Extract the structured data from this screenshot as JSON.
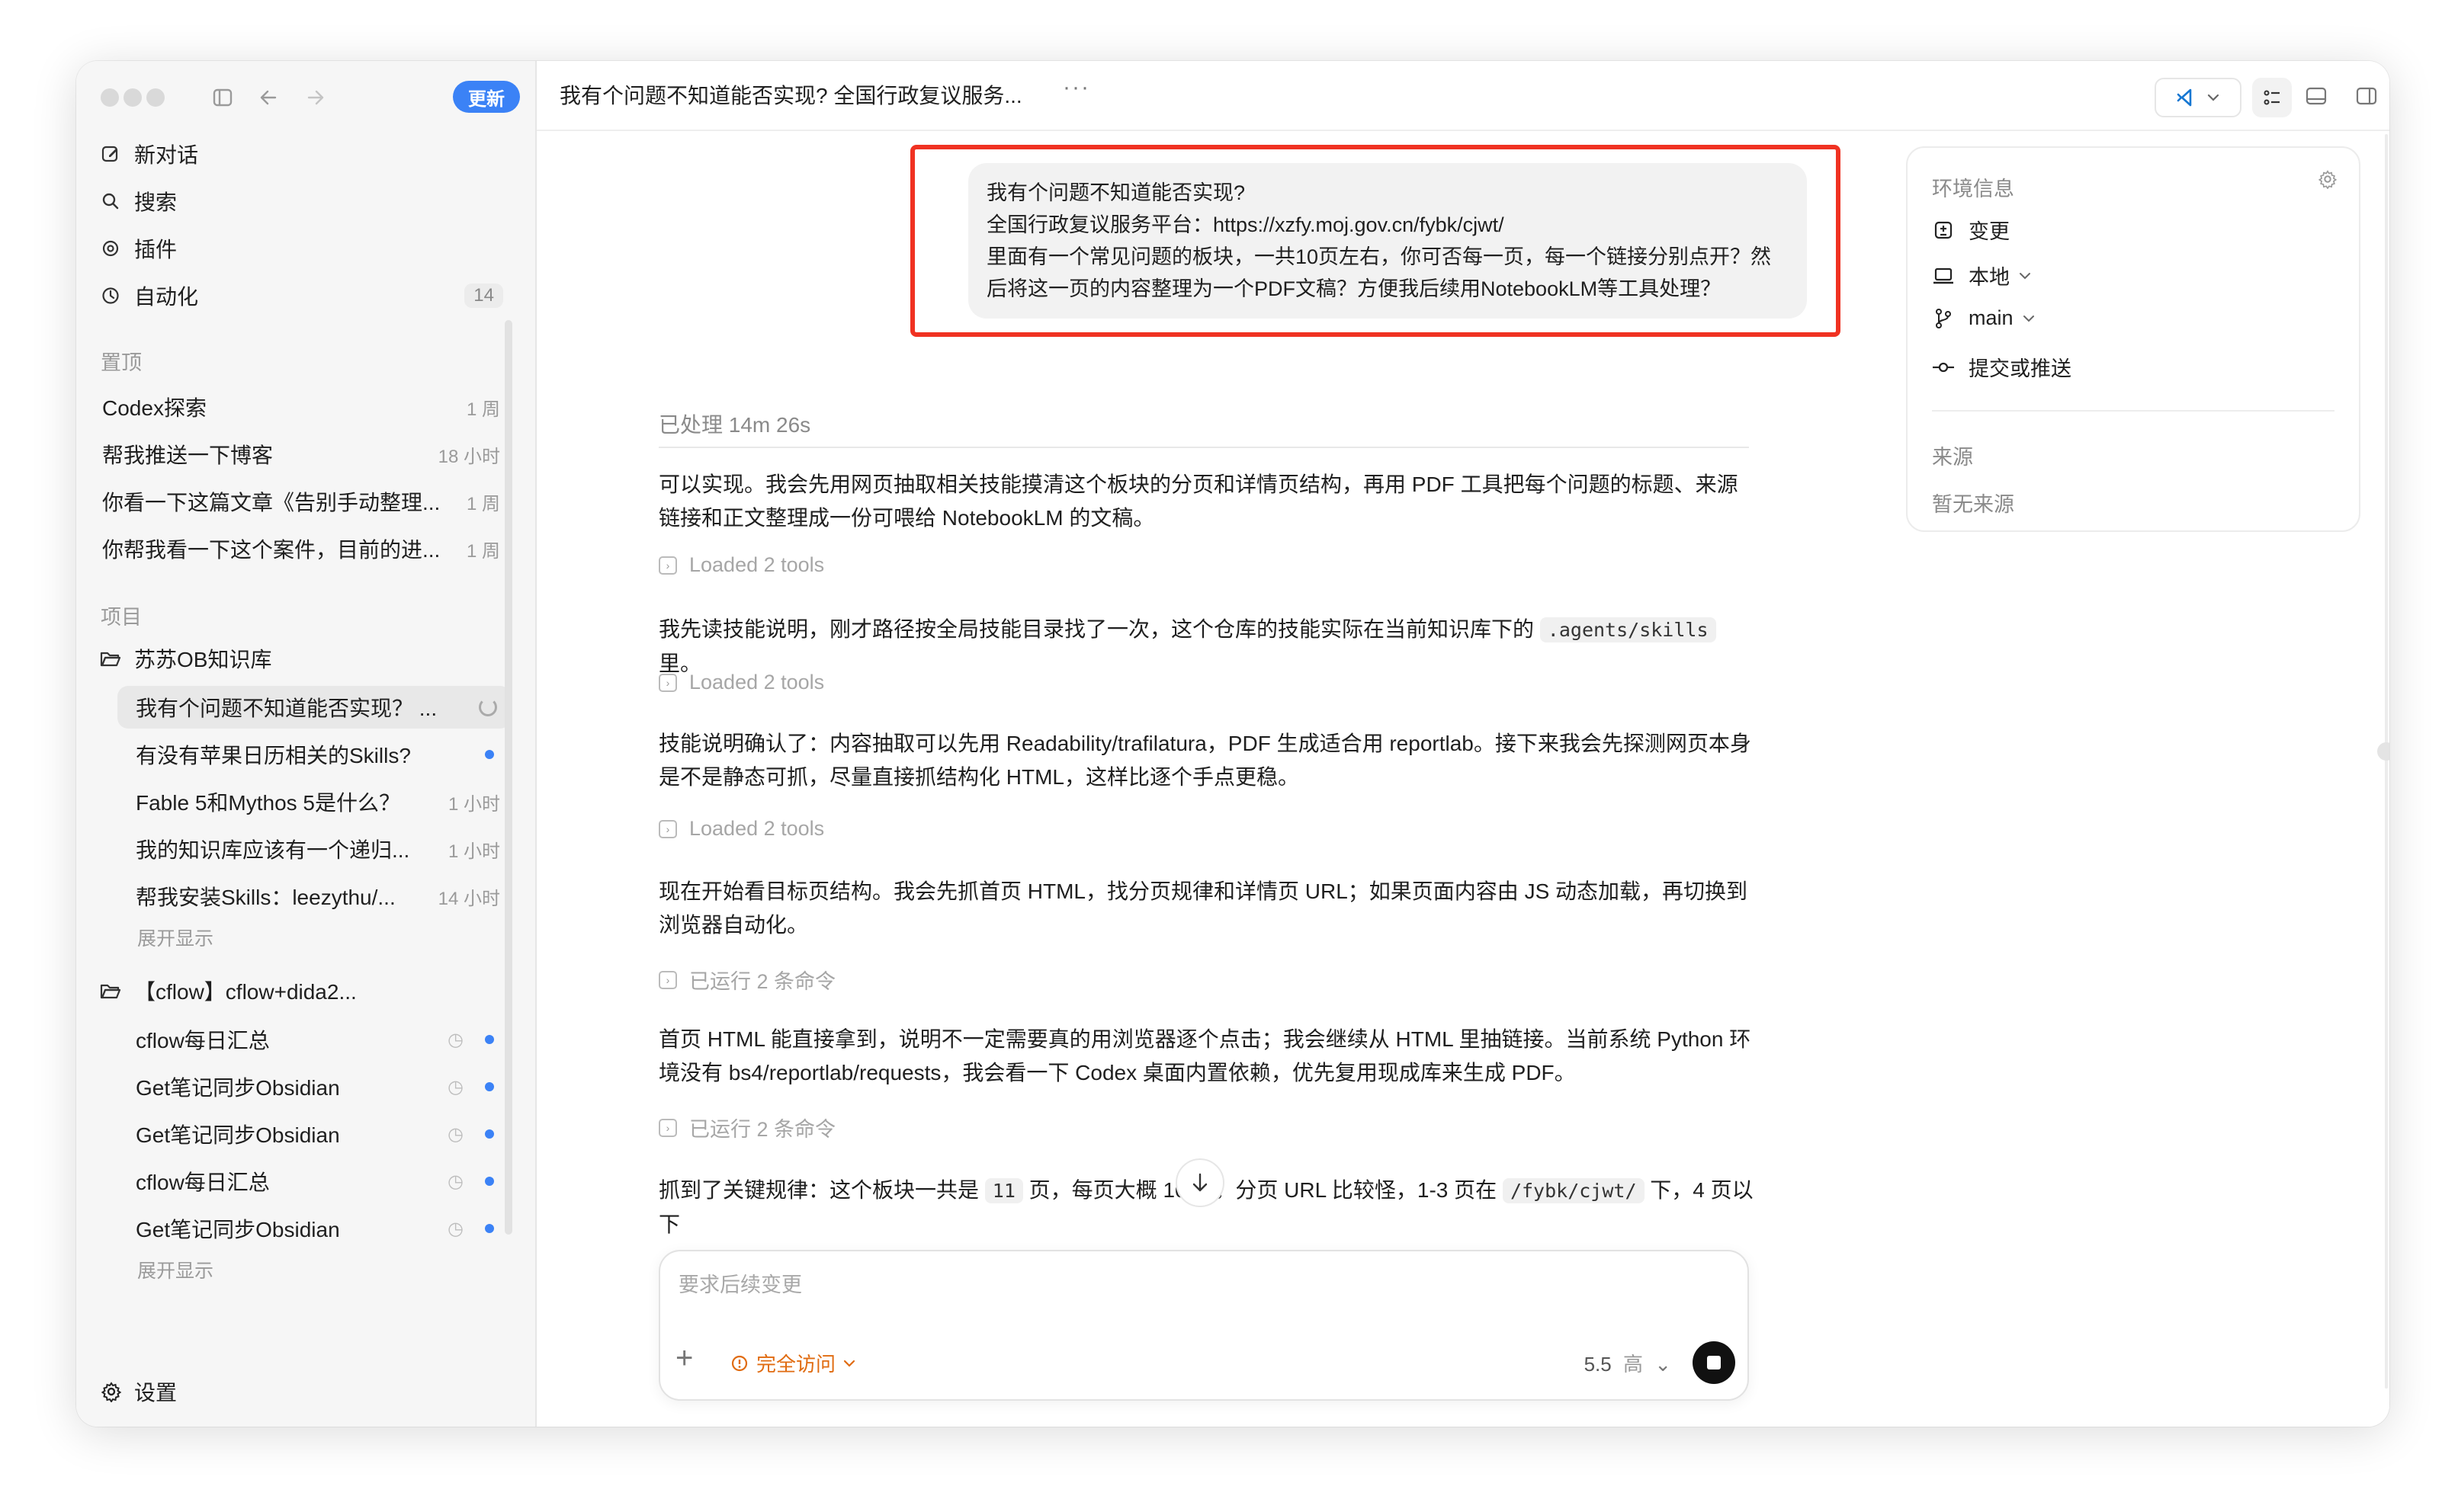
{
  "sidebar": {
    "update_label": "更新",
    "nav": [
      {
        "label": "新对话"
      },
      {
        "label": "搜索"
      },
      {
        "label": "插件"
      },
      {
        "label": "自动化",
        "badge": "14"
      }
    ],
    "pinned_label": "置顶",
    "pinned": [
      {
        "title": "Codex探索",
        "time": "1 周"
      },
      {
        "title": "帮我推送一下博客",
        "time": "18 小时"
      },
      {
        "title": "你看一下这篇文章《告别手动整理...",
        "time": "1 周"
      },
      {
        "title": "你帮我看一下这个案件，目前的进...",
        "time": "1 周"
      }
    ],
    "projects_label": "项目",
    "project1": {
      "name": "苏苏OB知识库",
      "threads": [
        {
          "title": "我有个问题不知道能否实现？ ...",
          "time": ""
        },
        {
          "title": "有没有苹果日历相关的Skills?",
          "time": ""
        },
        {
          "title": "Fable 5和Mythos 5是什么？",
          "time": "1 小时"
        },
        {
          "title": "我的知识库应该有一个递归...",
          "time": "1 小时"
        },
        {
          "title": "帮我安装Skills：leezythu/...",
          "time": "14 小时"
        }
      ],
      "expand": "展开显示"
    },
    "project2": {
      "name": "【cflow】cflow+dida2...",
      "threads": [
        {
          "title": "cflow每日汇总"
        },
        {
          "title": "Get笔记同步Obsidian"
        },
        {
          "title": "Get笔记同步Obsidian"
        },
        {
          "title": "cflow每日汇总"
        },
        {
          "title": "Get笔记同步Obsidian"
        }
      ],
      "expand": "展开显示"
    },
    "settings_label": "设置"
  },
  "topbar": {
    "title": "我有个问题不知道能否实现?  全国行政复议服务...",
    "more": "···"
  },
  "chat": {
    "user_message": [
      "我有个问题不知道能否实现?",
      "全国行政复议服务平台：https://xzfy.moj.gov.cn/fybk/cjwt/",
      "里面有一个常见问题的板块，一共10页左右，你可否每一页，每一个链接分别点开？然",
      "后将这一页的内容整理为一个PDF文稿？方便我后续用NotebookLM等工具处理？"
    ],
    "processed": "已处理 14m 26s",
    "p1": "可以实现。我会先用网页抽取相关技能摸清这个板块的分页和详情页结构，再用 PDF 工具把每个问题的标题、来源链接和正文整理成一份可喂给 NotebookLM 的文稿。",
    "tool1": "Loaded 2 tools",
    "p2_pre": "我先读技能说明，刚才路径按全局技能目录找了一次，这个仓库的技能实际在当前知识库下的 ",
    "p2_code": ".agents/skills",
    "p2_post": " 里。",
    "tool2": "Loaded 2 tools",
    "p3": "技能说明确认了：内容抽取可以先用 Readability/trafilatura，PDF 生成适合用 reportlab。接下来我会先探测网页本身是不是静态可抓，尽量直接抓结构化 HTML，这样比逐个手点更稳。",
    "tool3": "Loaded 2 tools",
    "p4": "现在开始看目标页结构。我会先抓首页 HTML，找分页规律和详情页 URL；如果页面内容由 JS 动态加载，再切换到浏览器自动化。",
    "tool4": "已运行 2 条命令",
    "p5": "首页 HTML 能直接拿到，说明不一定需要真的用浏览器逐个点击；我会继续从 HTML 里抽链接。当前系统 Python 环境没有 bs4/reportlab/requests，我会看一下 Codex 桌面内置依赖，优先复用现成库来生成 PDF。",
    "tool5": "已运行 2 条命令",
    "p6_a": "抓到了关键规律：这个板块一共是 ",
    "p6_code1": "11",
    "p6_b": " 页，每页大概 10 条。分页 URL 比较怪，1-3 页在 ",
    "p6_code2": "/fybk/cjwt/",
    "p6_c": " 下，4 页以下"
  },
  "composer": {
    "placeholder": "要求后续变更",
    "access": "完全访问",
    "model": "5.5",
    "effort": "高"
  },
  "env": {
    "title": "环境信息",
    "items": [
      {
        "label": "变更"
      },
      {
        "label": "本地"
      },
      {
        "label": "main"
      },
      {
        "label": "提交或推送"
      }
    ],
    "source_label": "来源",
    "source_empty": "暂无来源"
  },
  "colors": {
    "accent": "#3b82f6",
    "highlight": "#f03222",
    "warning": "#e06b10"
  }
}
